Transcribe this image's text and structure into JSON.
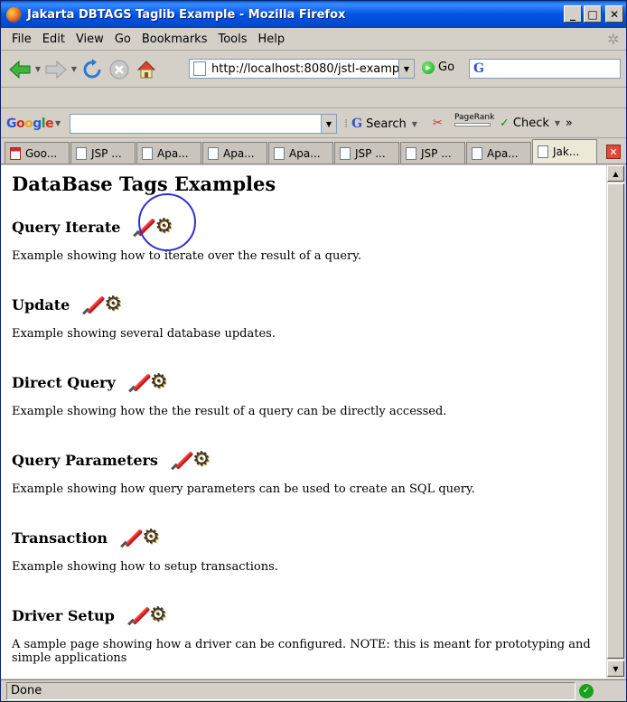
{
  "window": {
    "title": "Jakarta DBTAGS Taglib Example - Mozilla Firefox",
    "minimize": "_",
    "maximize": "□",
    "close": "✕"
  },
  "menu": [
    "File",
    "Edit",
    "View",
    "Go",
    "Bookmarks",
    "Tools",
    "Help"
  ],
  "nav": {
    "url": "http://localhost:8080/jstl-examp",
    "go_label": "Go",
    "search_value": ""
  },
  "google_toolbar": {
    "logo": [
      "G",
      "o",
      "o",
      "g",
      "l",
      "e"
    ],
    "search_label": "Search",
    "pagerank_label": "PageRank",
    "check_label": "Check",
    "more": "»"
  },
  "tabs": [
    {
      "label": "Goo...",
      "icon": "calendar-icon"
    },
    {
      "label": "JSP ...",
      "icon": "page-icon"
    },
    {
      "label": "Apa...",
      "icon": "page-icon"
    },
    {
      "label": "Apa...",
      "icon": "page-icon"
    },
    {
      "label": "Apa...",
      "icon": "page-icon"
    },
    {
      "label": "JSP ...",
      "icon": "page-icon"
    },
    {
      "label": "JSP ...",
      "icon": "page-icon"
    },
    {
      "label": "Apa...",
      "icon": "page-icon"
    },
    {
      "label": "Jak...",
      "icon": "page-icon",
      "active": true
    }
  ],
  "page": {
    "title": "DataBase Tags Examples",
    "sections": [
      {
        "title": "Query Iterate",
        "desc": "Example showing how to iterate over the result of a query."
      },
      {
        "title": "Update",
        "desc": "Example showing several database updates."
      },
      {
        "title": "Direct Query",
        "desc": "Example showing how the the result of a query can be directly accessed."
      },
      {
        "title": "Query Parameters",
        "desc": "Example showing how query parameters can be used to create an SQL query."
      },
      {
        "title": "Transaction",
        "desc": "Example showing how to setup transactions."
      },
      {
        "title": "Driver Setup",
        "desc": "A sample page showing how a driver can be configured. NOTE: this is meant for prototyping and simple applications"
      }
    ]
  },
  "status": {
    "text": "Done"
  },
  "colors": {
    "titlebar": "#0055e5",
    "highlight_circle": "#3030d0"
  }
}
